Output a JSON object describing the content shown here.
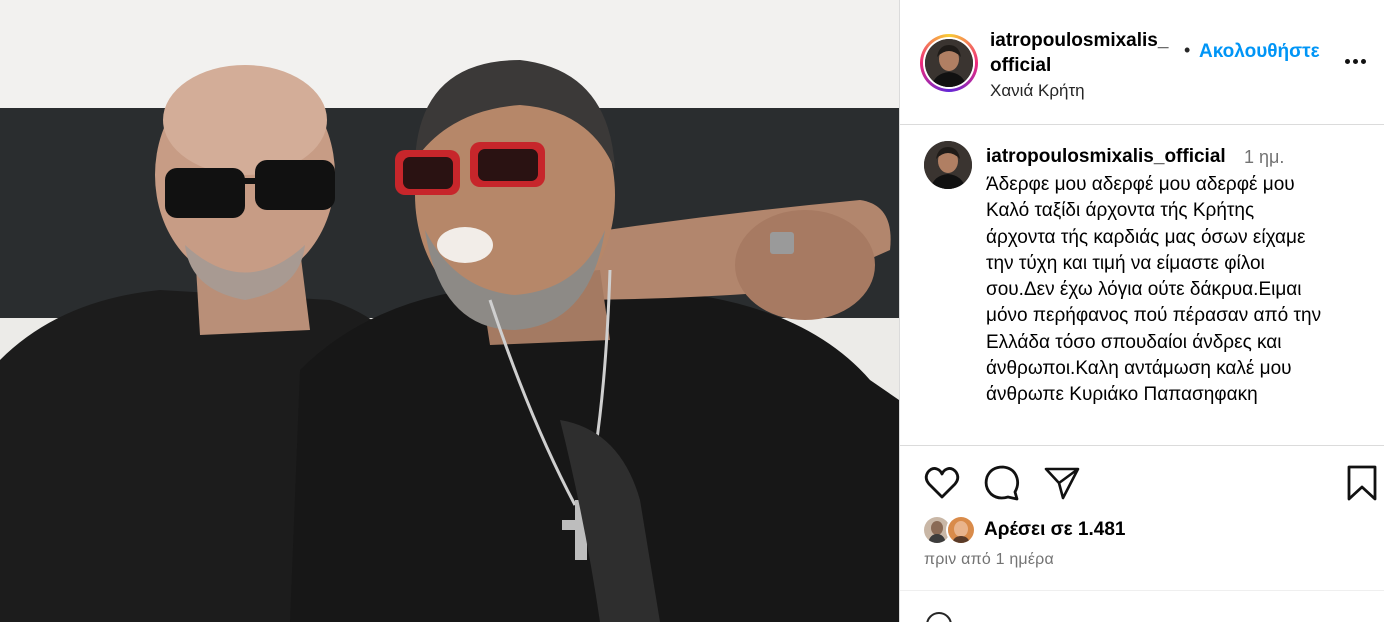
{
  "post": {
    "photo_alt": "two men",
    "author": {
      "username_line1": "iatropoulosmixalis_",
      "username_line2": "official",
      "location": "Χανιά Κρήτη",
      "separator": "•",
      "follow_label": "Ακολουθήστε"
    },
    "caption": {
      "username": "iatropoulosmixalis_official",
      "time_ago": "1 ημ.",
      "text": "Άδερφε μου αδερφέ μου αδερφέ μου\nΚαλό ταξίδι άρχοντα τής Κρήτης\nάρχοντα τής καρδιάς μας όσων είχαμε\nτην τύχη και τιμή να είμαστε φίλοι\nσου.Δεν έχω λόγια ούτε δάκρυα.Ειμαι\nμόνο περήφανος πού πέρασαν από την\nΕλλάδα τόσο σπουδαίοι άνδρες και\nάνθρωποι.Καλη αντάμωση καλέ μου\nάνθρωπε Κυριάκο Παπασηφακη"
    },
    "actions": {
      "icons": [
        "heart-icon",
        "comment-icon",
        "share-icon",
        "bookmark-icon"
      ]
    },
    "likes": {
      "label": "Αρέσει σε 1.481"
    },
    "date": "πριν από 1 ημέρα"
  },
  "colors": {
    "follow": "#0095f6",
    "muted": "#737373",
    "divider": "#dbdbdb"
  }
}
